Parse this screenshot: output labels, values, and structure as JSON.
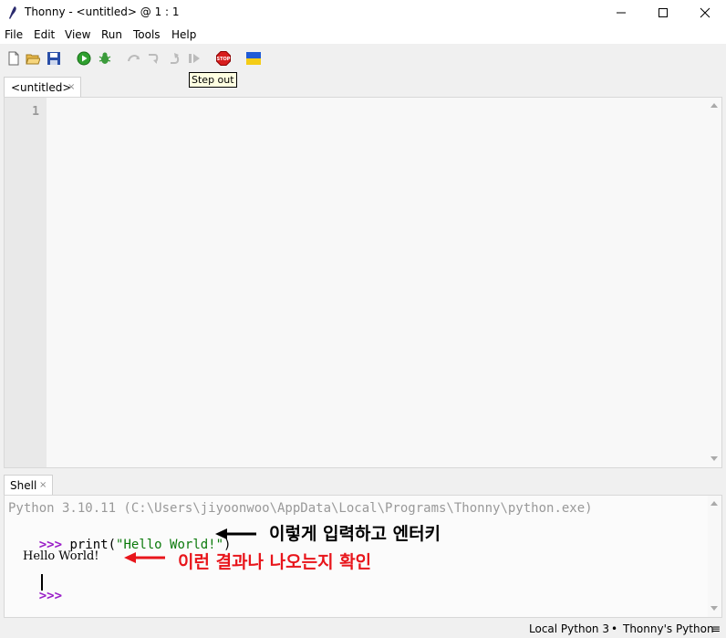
{
  "window": {
    "title": "Thonny  -  <untitled>  @  1 : 1"
  },
  "menu": [
    "File",
    "Edit",
    "View",
    "Run",
    "Tools",
    "Help"
  ],
  "toolbar": {
    "tooltip": "Step out",
    "icons": [
      "new-file-icon",
      "open-file-icon",
      "save-icon",
      "run-icon",
      "debug-icon",
      "step-over-icon",
      "step-into-icon",
      "step-out-icon",
      "resume-icon",
      "stop-icon",
      "ukraine-flag-icon"
    ]
  },
  "editor": {
    "tab_label": "<untitled>",
    "tab_close": "×",
    "line_number": "1"
  },
  "shell": {
    "tab_label": "Shell",
    "tab_close": "×",
    "banner": "Python 3.10.11 (C:\\Users\\jiyoonwoo\\AppData\\Local\\Programs\\Thonny\\python.exe)",
    "prompt": ">>>",
    "cmd_prefix": "print(",
    "cmd_string": "\"Hello World!\"",
    "cmd_suffix": ")",
    "output": "Hello World!",
    "annotation_1": "이렇게 입력하고 엔터키",
    "annotation_2": "이런 결과나 나오는지 확인",
    "annotation_1_color": "#000000",
    "annotation_2_color": "#e8151b"
  },
  "status": {
    "interpreter": "Local Python 3",
    "separator": "•",
    "python": "Thonny's Python",
    "menu_icon": "≡"
  },
  "colors": {
    "prompt": "#9a1ec8",
    "string": "#0b7a0b",
    "banner": "#999999"
  }
}
